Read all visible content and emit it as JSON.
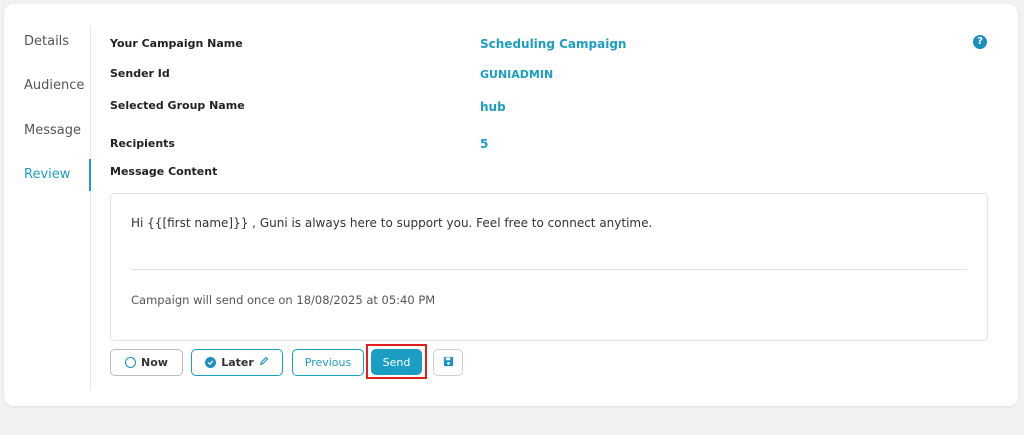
{
  "sidebar": {
    "items": [
      {
        "label": "Details"
      },
      {
        "label": "Audience"
      },
      {
        "label": "Message"
      },
      {
        "label": "Review"
      }
    ]
  },
  "review": {
    "campaign_name_label": "Your Campaign Name",
    "campaign_name_value": "Scheduling Campaign",
    "sender_id_label": "Sender Id",
    "sender_id_value": "GUNIADMIN",
    "group_label": "Selected Group Name",
    "group_value": "hub",
    "recipients_label": "Recipients",
    "recipients_value": "5",
    "message_content_label": "Message Content"
  },
  "message": {
    "text": "Hi {{[first name]}} , Guni is always here to support you. Feel free to connect anytime.",
    "schedule": "Campaign will send once on 18/08/2025 at 05:40 PM"
  },
  "actions": {
    "now_label": "Now",
    "later_label": "Later",
    "previous_label": "Previous",
    "send_label": "Send"
  },
  "icons": {
    "help": "question-circle-icon",
    "radio": "radio-empty-icon",
    "check": "check-circle-icon",
    "edit": "pencil-icon",
    "save": "floppy-disk-icon"
  },
  "colors": {
    "accent": "#1b9dc4",
    "highlight": "#e02020"
  }
}
